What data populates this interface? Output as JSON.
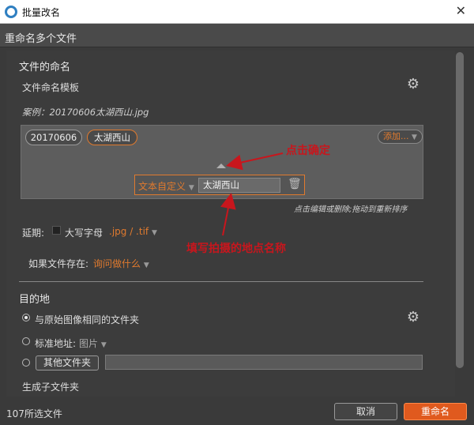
{
  "window": {
    "title": "批量改名",
    "close_symbol": "✕"
  },
  "header": {
    "title": "重命名多个文件"
  },
  "naming": {
    "section_title": "文件的命名",
    "template_label": "文件命名模板",
    "example": "案例：20170606太湖西山.jpg",
    "tokens": [
      "20170606",
      "太湖西山"
    ],
    "add_button": "添加...",
    "edit_row": {
      "type": "文本自定义",
      "value": "太湖西山"
    },
    "hint": "点击编辑或删除;拖动到重新排序",
    "extension": {
      "label": "延期:",
      "uppercase_label": "大写字母",
      "value": ".jpg / .tif"
    },
    "if_exists": {
      "label": "如果文件存在:",
      "value": "询问做什么"
    }
  },
  "annotations": {
    "confirm": "点击确定",
    "fill_location": "填写拍摄的地点名称",
    "color": "#c8161d"
  },
  "destination": {
    "section_title": "目的地",
    "options": {
      "same_folder": "与原始图像相同的文件夹",
      "standard_label": "标准地址:",
      "standard_value": "图片",
      "other_folder_button": "其他文件夹"
    },
    "subfolder_label": "生成子文件夹"
  },
  "footer": {
    "selected_count": "107所选文件",
    "cancel": "取消",
    "rename": "重命名"
  },
  "colors": {
    "accent": "#e07a2e",
    "primary_button": "#e05a1e"
  }
}
